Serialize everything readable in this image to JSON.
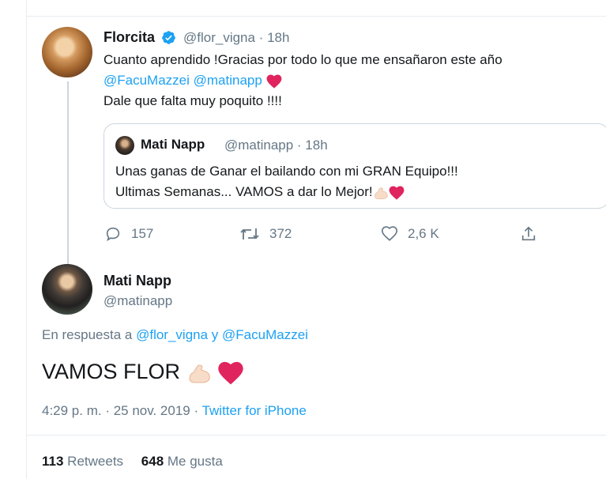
{
  "tweet1": {
    "name": "Florcita",
    "handle_time": "@flor_vigna · 18h",
    "line1": "Cuanto aprendido !Gracias por todo lo que me ensañaron este año",
    "mention_a": "@FacuMazzei",
    "mention_b": "@matinapp",
    "line3": "Dale que falta muy poquito !!!!"
  },
  "quoted": {
    "name": "Mati Napp",
    "handle_time": "@matinapp · 18h",
    "line1": "Unas ganas de Ganar el bailando con mi GRAN Equipo!!!",
    "line2": "Ultimas Semanas... VAMOS a dar lo Mejor!"
  },
  "actions": {
    "replies": "157",
    "retweets": "372",
    "likes": "2,6 K"
  },
  "tweet2": {
    "name": "Mati Napp",
    "handle": "@matinapp",
    "reply_prefix": "En respuesta a",
    "reply_to_a": "@flor_vigna",
    "reply_join": "y",
    "reply_to_b": "@FacuMazzei",
    "text": "VAMOS FLOR",
    "timestamp": "4:29 p. m. · 25 nov. 2019 ·",
    "source": "Twitter for iPhone",
    "retweet_count": "113",
    "retweet_label": "Retweets",
    "like_count": "648",
    "like_label": "Me gusta"
  },
  "colors": {
    "accent": "#1da1f2",
    "secondary_text": "#657786",
    "heart": "#e0245e"
  },
  "icons": [
    "verified-badge-icon",
    "heart-emoji-icon",
    "flexed-biceps-emoji-icon",
    "reply-icon",
    "retweet-icon",
    "like-icon",
    "share-icon"
  ]
}
